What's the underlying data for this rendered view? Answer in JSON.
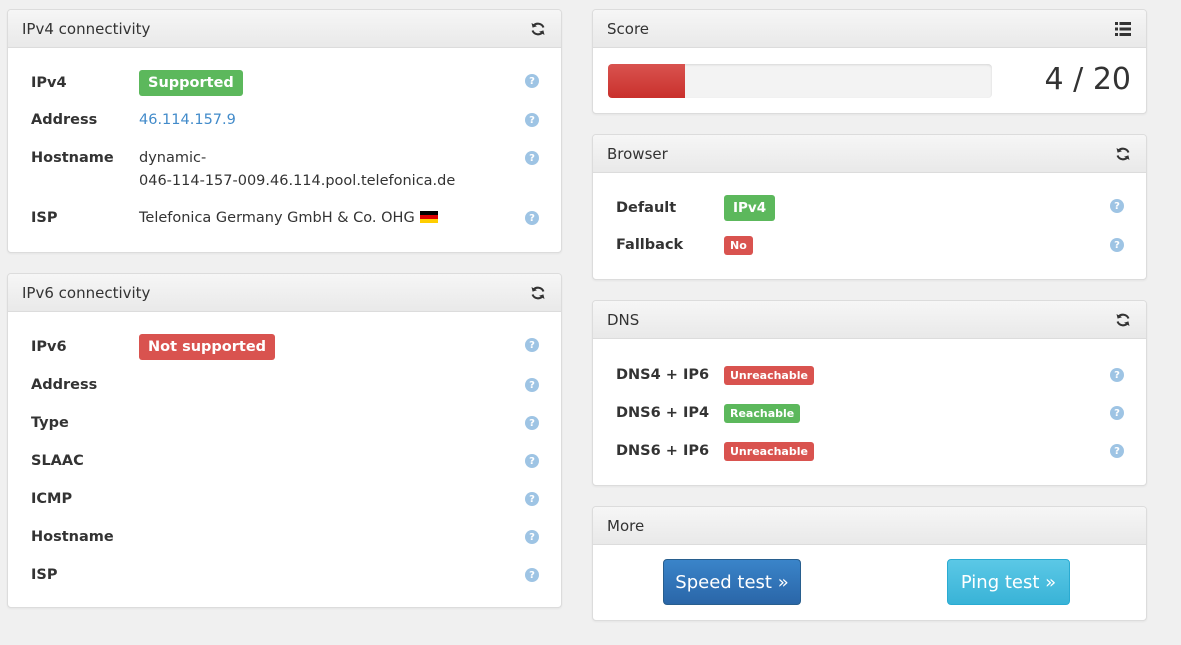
{
  "ipv4": {
    "title": "IPv4 connectivity",
    "refresh_icon": "refresh-icon",
    "rows": {
      "ipv4": {
        "label": "IPv4",
        "badge": "Supported"
      },
      "address": {
        "label": "Address",
        "value": "46.114.157.9"
      },
      "hostname": {
        "label": "Hostname",
        "value_line1": "dynamic-",
        "value_line2": "046-114-157-009.46.114.pool.telefonica.de"
      },
      "isp": {
        "label": "ISP",
        "value": "Telefonica Germany GmbH & Co. OHG",
        "flag_icon": "german-flag-icon"
      }
    }
  },
  "ipv6": {
    "title": "IPv6 connectivity",
    "refresh_icon": "refresh-icon",
    "rows": {
      "ipv6": {
        "label": "IPv6",
        "badge": "Not supported"
      },
      "address": {
        "label": "Address"
      },
      "type": {
        "label": "Type"
      },
      "slaac": {
        "label": "SLAAC"
      },
      "icmp": {
        "label": "ICMP"
      },
      "hostname": {
        "label": "Hostname"
      },
      "isp": {
        "label": "ISP"
      }
    }
  },
  "score": {
    "title": "Score",
    "list_icon": "list-icon",
    "value_text": "4 / 20",
    "progress_fraction": 0.2,
    "bar_color": "#d9534f"
  },
  "browser": {
    "title": "Browser",
    "refresh_icon": "refresh-icon",
    "rows": {
      "default": {
        "label": "Default",
        "badge": "IPv4"
      },
      "fallback": {
        "label": "Fallback",
        "badge": "No"
      }
    }
  },
  "dns": {
    "title": "DNS",
    "refresh_icon": "refresh-icon",
    "rows": {
      "dns4_ip6": {
        "label": "DNS4 + IP6",
        "badge": "Unreachable"
      },
      "dns6_ip4": {
        "label": "DNS6 + IP4",
        "badge": "Reachable"
      },
      "dns6_ip6": {
        "label": "DNS6 + IP6",
        "badge": "Unreachable"
      }
    }
  },
  "more": {
    "title": "More",
    "speed_test_label": "Speed test »",
    "ping_test_label": "Ping test »"
  },
  "help_icon_glyph": "?",
  "colors": {
    "success": "#5cb85c",
    "danger": "#d9534f",
    "link": "#428bca",
    "primary": "#2a66a8",
    "info": "#39b3d7"
  }
}
